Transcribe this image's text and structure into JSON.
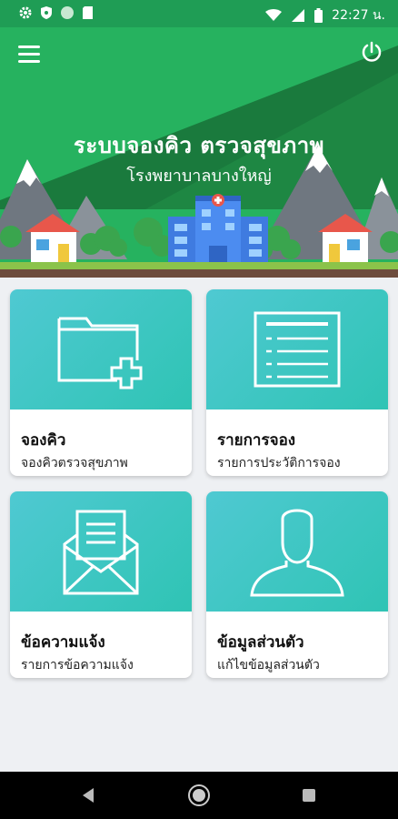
{
  "status_bar": {
    "time": "22:27 น.",
    "icons": [
      "gear-icon",
      "shield-icon",
      "circle-icon",
      "sd-card-icon",
      "wifi-icon",
      "signal-icon",
      "battery-icon"
    ]
  },
  "header": {
    "title": "ระบบจองคิว ตรวจสุขภาพ",
    "subtitle": "โรงพยาบาลบางใหญ่",
    "colors": {
      "green": "#26b25f",
      "dark_green": "#1a7a3d"
    }
  },
  "cards": [
    {
      "title": "จองคิว",
      "subtitle": "จองคิวตรวจสุขภาพ",
      "icon": "folder-add-icon"
    },
    {
      "title": "รายการจอง",
      "subtitle": "รายการประวัติการจอง",
      "icon": "list-document-icon"
    },
    {
      "title": "ข้อความแจ้ง",
      "subtitle": "รายการข้อความแจ้ง",
      "icon": "mail-open-icon"
    },
    {
      "title": "ข้อมูลส่วนตัว",
      "subtitle": "แก้ไขข้อมูลส่วนตัว",
      "icon": "user-icon"
    }
  ],
  "theme": {
    "accent": "#4fc9d2",
    "card_bg": "#ffffff",
    "page_bg": "#eef0f3"
  }
}
